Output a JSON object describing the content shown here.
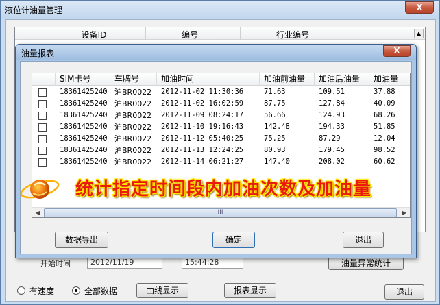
{
  "main_window": {
    "title": "液位计油量管理",
    "close_label": "X",
    "device_grid": {
      "columns": [
        "设备ID",
        "编号",
        "行业编号"
      ]
    },
    "partial_label": "开始时间",
    "date_field": "2012/11/19",
    "time_field": "15:44:28",
    "stat_button": "油量异常统计",
    "radio_speed": "有速度",
    "radio_all": "全部数据",
    "curve_button": "曲线显示",
    "report_button": "报表显示",
    "exit_button": "退出"
  },
  "dialog": {
    "title": "油量报表",
    "close_label": "X",
    "columns": [
      "SIM卡号",
      "车牌号",
      "加油时间",
      "加油前油量",
      "加油后油量",
      "加油量"
    ],
    "rows": [
      {
        "sim": "18361425240",
        "plate": "沪BR0022",
        "time": "2012-11-02 11:30:36",
        "before": "71.63",
        "after": "109.51",
        "amount": "37.88"
      },
      {
        "sim": "18361425240",
        "plate": "沪BR0022",
        "time": "2012-11-02 16:02:59",
        "before": "87.75",
        "after": "127.84",
        "amount": "40.09"
      },
      {
        "sim": "18361425240",
        "plate": "沪BR0022",
        "time": "2012-11-09 08:24:17",
        "before": "56.66",
        "after": "124.93",
        "amount": "68.26"
      },
      {
        "sim": "18361425240",
        "plate": "沪BR0022",
        "time": "2012-11-10 19:16:43",
        "before": "142.48",
        "after": "194.33",
        "amount": "51.85"
      },
      {
        "sim": "18361425240",
        "plate": "沪BR0022",
        "time": "2012-11-12 05:40:25",
        "before": "75.25",
        "after": "87.29",
        "amount": "12.04"
      },
      {
        "sim": "18361425240",
        "plate": "沪BR0022",
        "time": "2012-11-13 12:24:25",
        "before": "80.93",
        "after": "179.45",
        "amount": "98.52"
      },
      {
        "sim": "18361425240",
        "plate": "沪BR0022",
        "time": "2012-11-14 06:21:27",
        "before": "147.40",
        "after": "208.02",
        "amount": "60.62"
      }
    ],
    "scroll_thumb": "III",
    "export_button": "数据导出",
    "ok_button": "确定",
    "exit_button": "退出"
  },
  "banner": {
    "text": "统计指定时间段内加油次数及加油量",
    "colors": {
      "text": "#e81b0e",
      "outline": "#ffe800",
      "logo": "#f07a10"
    }
  }
}
